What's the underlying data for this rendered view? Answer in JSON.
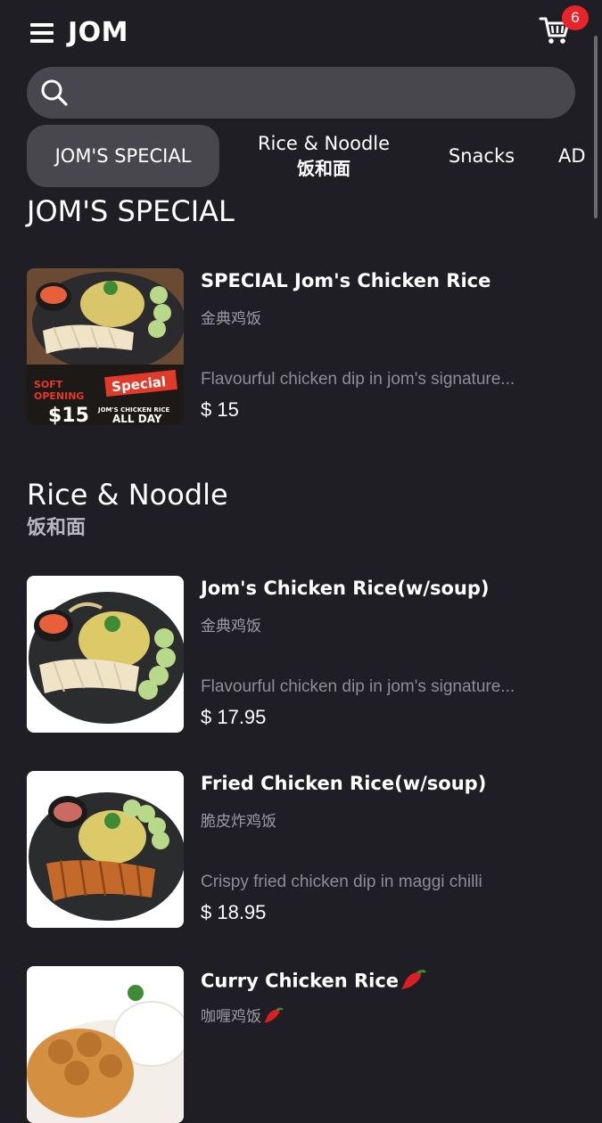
{
  "header": {
    "brand": "JOM",
    "cart_count": "6"
  },
  "search": {
    "placeholder": "",
    "value": ""
  },
  "tabs": [
    {
      "label": "JOM'S SPECIAL",
      "sub": "",
      "active": true
    },
    {
      "label": "Rice & Noodle",
      "sub": "饭和面",
      "active": false
    },
    {
      "label": "Snacks",
      "sub": "",
      "active": false
    },
    {
      "label": "AD",
      "sub": "",
      "active": false
    }
  ],
  "sections": [
    {
      "title": "JOM'S SPECIAL",
      "sub": "",
      "items": [
        {
          "name": "SPECIAL Jom's Chicken Rice",
          "cn": "金典鸡饭",
          "desc": "Flavourful chicken dip in jom's signature...",
          "price": "$ 15",
          "promo": {
            "line1": "SOFT",
            "line2": "OPENING",
            "tag": "Special",
            "price": "$15",
            "sub1": "JOM'S CHICKEN RICE",
            "sub2": "ALL DAY"
          }
        }
      ]
    },
    {
      "title": "Rice & Noodle",
      "sub": "饭和面",
      "items": [
        {
          "name": "Jom's Chicken Rice(w/soup)",
          "cn": "金典鸡饭",
          "desc": "Flavourful chicken dip in jom's signature...",
          "price": "$ 17.95"
        },
        {
          "name": "Fried Chicken Rice(w/soup)",
          "cn": "脆皮炸鸡饭",
          "desc": "Crispy fried chicken dip in maggi chilli",
          "price": "$ 18.95"
        },
        {
          "name": "Curry Chicken Rice",
          "cn": "咖喱鸡饭",
          "desc": "",
          "price": ""
        }
      ]
    }
  ],
  "colors": {
    "background": "#1f1e24",
    "surface": "#48474e",
    "badge": "#e8242a",
    "muted_text": "#9c9ba5"
  },
  "icons": [
    "menu-icon",
    "cart-icon",
    "search-icon",
    "chili-icon"
  ]
}
